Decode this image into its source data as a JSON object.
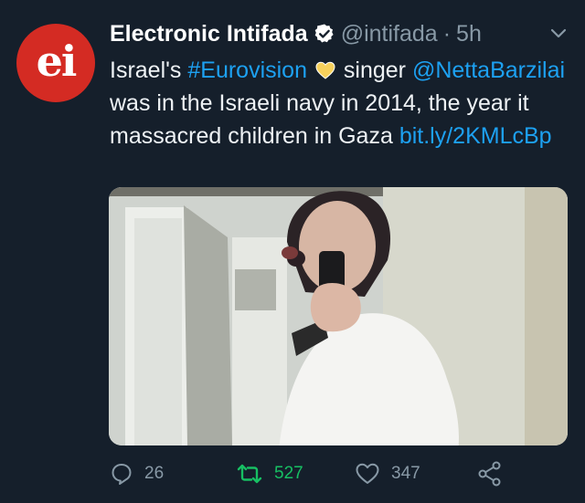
{
  "tweet": {
    "avatar_text": "ei",
    "display_name": "Electronic Intifada",
    "handle": "@intifada",
    "separator": "·",
    "time": "5h",
    "text": {
      "part1": "Israel's ",
      "hashtag": "#Eurovision",
      "part2": " singer ",
      "mention": "@NettaBarzilai",
      "part3": " was in the Israeli navy in 2014, the year it massacred children in Gaza ",
      "link": "bit.ly/2KMLcBp"
    },
    "actions": {
      "replies": "26",
      "retweets": "527",
      "likes": "347"
    }
  },
  "colors": {
    "background": "#151f2b",
    "link": "#1da1f2",
    "muted": "#8899a6",
    "retweet_active": "#17bf63",
    "avatar": "#d42b23"
  },
  "icons": [
    "verified-badge-icon",
    "chevron-down-icon",
    "yellow-heart-emoji",
    "reply-icon",
    "retweet-icon",
    "like-icon",
    "share-icon"
  ]
}
